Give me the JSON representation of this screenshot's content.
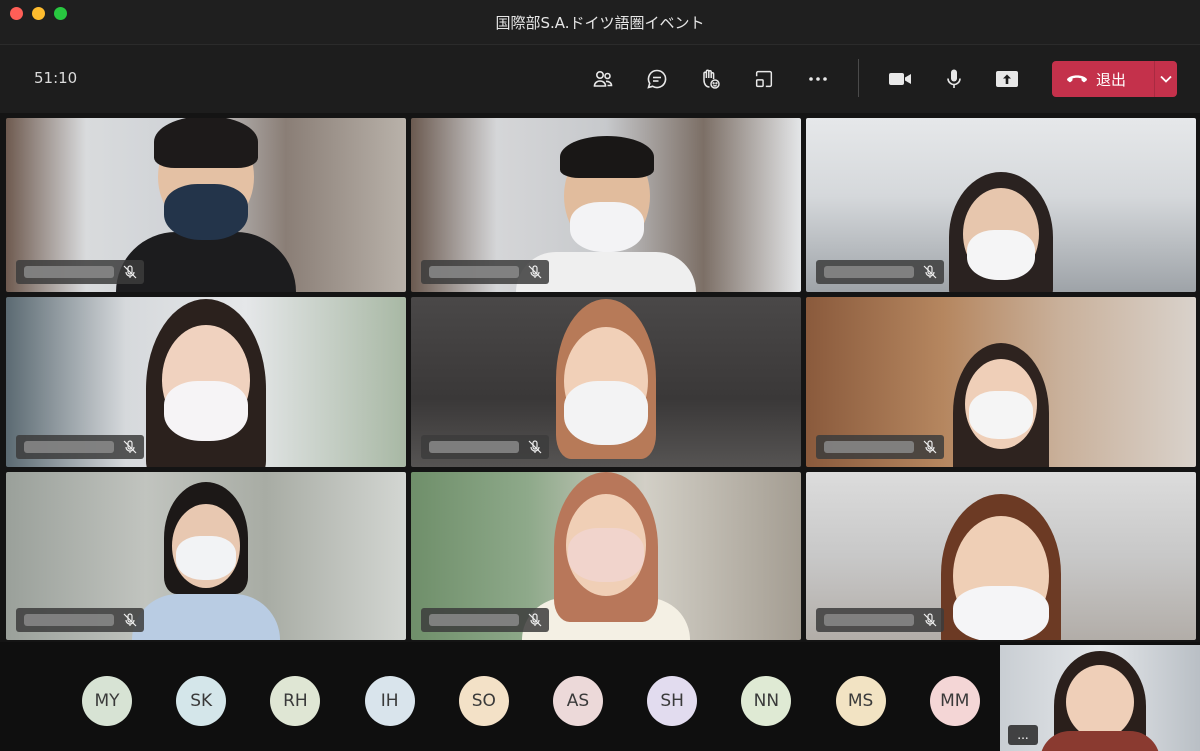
{
  "window": {
    "title": "国際部S.A.ドイツ語圏イベント"
  },
  "toolbar": {
    "timer": "51:10",
    "leave_label": "退出",
    "icons": [
      "people-icon",
      "chat-icon",
      "raise-hand-icon",
      "share-tray-icon",
      "more-icon",
      "camera-icon",
      "microphone-icon",
      "share-screen-icon",
      "phone-hangup-icon",
      "chevron-down-icon"
    ]
  },
  "participants_row": [
    {
      "initials": "MY",
      "color": "#d7e3d4"
    },
    {
      "initials": "SK",
      "color": "#d4e6ea"
    },
    {
      "initials": "RH",
      "color": "#dfe6d4"
    },
    {
      "initials": "IH",
      "color": "#d9e4ec"
    },
    {
      "initials": "SO",
      "color": "#f3e1c7"
    },
    {
      "initials": "AS",
      "color": "#ecd9d9"
    },
    {
      "initials": "SH",
      "color": "#e2dcef"
    },
    {
      "initials": "NN",
      "color": "#dfead4"
    },
    {
      "initials": "MS",
      "color": "#f2e3c3"
    },
    {
      "initials": "MM",
      "color": "#f4d6d6"
    }
  ],
  "video_tiles": [
    {
      "mic": "muted"
    },
    {
      "mic": "muted"
    },
    {
      "mic": "muted"
    },
    {
      "mic": "muted"
    },
    {
      "mic": "muted"
    },
    {
      "mic": "muted"
    },
    {
      "mic": "muted"
    },
    {
      "mic": "muted"
    },
    {
      "mic": "muted"
    }
  ],
  "self_view": {
    "more_label": "..."
  },
  "colors": {
    "leave_button": "#c4314b",
    "background": "#141414"
  }
}
